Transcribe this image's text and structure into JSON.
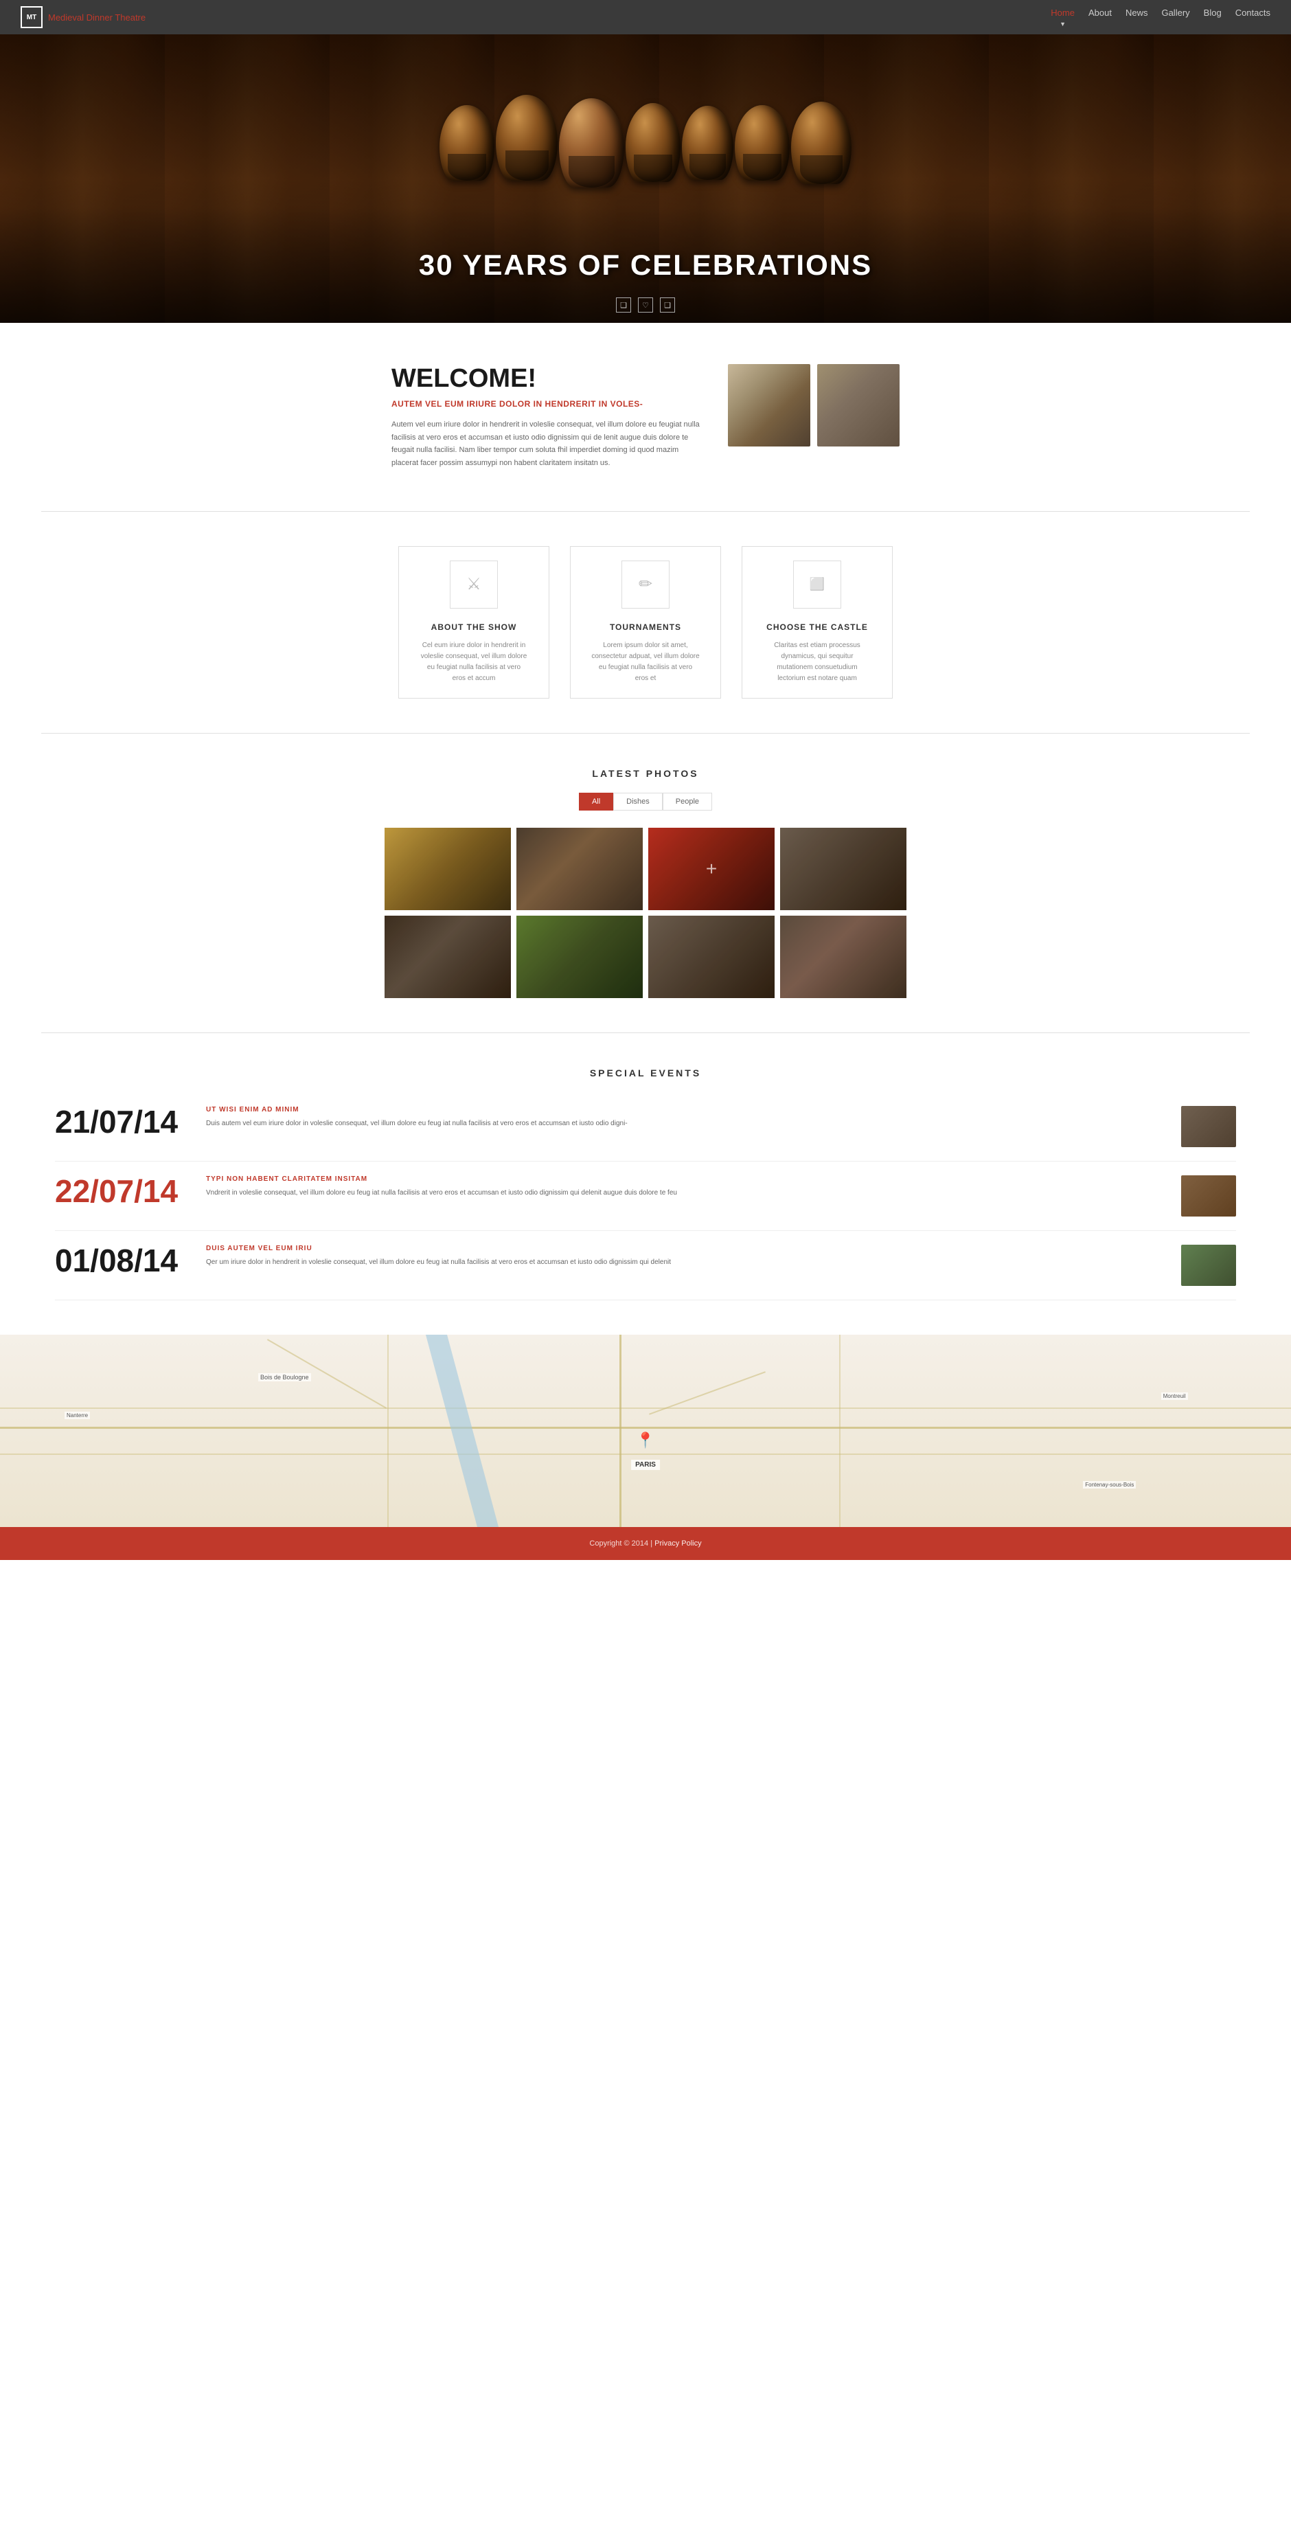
{
  "site": {
    "logo_initials": "MT",
    "logo_brand": "Medieval",
    "logo_highlight": " Dinner Theatre"
  },
  "nav": {
    "links": [
      {
        "label": "Home",
        "active": true
      },
      {
        "label": "About",
        "active": false
      },
      {
        "label": "News",
        "active": false
      },
      {
        "label": "Gallery",
        "active": false
      },
      {
        "label": "Blog",
        "active": false
      },
      {
        "label": "Contacts",
        "active": false
      }
    ]
  },
  "hero": {
    "title": "30 YEARS OF CELEBRATIONS"
  },
  "welcome": {
    "heading": "WELCOME!",
    "subtitle": "AUTEM VEL EUM IRIURE DOLOR IN HENDRERIT IN VOLES-",
    "body": "Autem vel eum iriure dolor in hendrerit in voleslie consequat, vel illum dolore eu feugiat nulla facilisis at vero eros et accumsan et iusto odio dignissim qui de lenit augue duis dolore te feugait nulla facilisi. Nam liber tempor cum soluta fhil imperdiet doming id quod mazim placerat facer possim assumypi non habent claritatem insitatn us."
  },
  "features": [
    {
      "icon": "⚔",
      "title": "ABOUT THE SHOW",
      "body": "Cel eum iriure dolor in hendrerit in voleslie consequat, vel illum dolore eu feugiat nulla facilisis at vero eros et accum"
    },
    {
      "icon": "✏",
      "title": "TOURNAMENTS",
      "body": "Lorem ipsum dolor sit amet, consectetur adpuat, vel illum dolore eu feugiat nulla facilisis at vero eros et"
    },
    {
      "icon": "⬜",
      "title": "CHOOSE THE CASTLE",
      "body": "Claritas est etiam processus dynamicus, qui sequitur mutationem consuetudium lectorium est notare quam"
    }
  ],
  "photos": {
    "section_title": "LATEST PHOTOS",
    "filters": [
      {
        "label": "All",
        "active": true
      },
      {
        "label": "Dishes",
        "active": false
      },
      {
        "label": "People",
        "active": false
      }
    ]
  },
  "events": {
    "section_title": "SPECIAL EVENTS",
    "items": [
      {
        "date": "21/07/14",
        "red": false,
        "tag": "UT WISI ENIM AD MINIM",
        "desc": "Duis autem vel eum iriure dolor in voleslie consequat, vel illum dolore eu feug iat nulla facilisis at vero eros et accumsan et iusto odio digni-"
      },
      {
        "date": "22/07/14",
        "red": true,
        "tag": "TYPI NON HABENT CLARITATEM INSITAM",
        "desc": "Vndrerit in voleslie consequat, vel illum dolore eu feug iat nulla facilisis at vero eros et accumsan et iusto odio dignissim qui  delenit augue duis dolore te feu"
      },
      {
        "date": "01/08/14",
        "red": false,
        "tag": "DUIS AUTEM VEL EUM IRIU",
        "desc": "Qer um iriure dolor in hendrerit in voleslie consequat, vel illum dolore eu feug iat nulla facilisis at vero eros et accumsan et iusto odio dignissim qui  delenit"
      }
    ]
  },
  "footer": {
    "text": "Copyright © 2014 |",
    "policy_label": "Privacy Policy"
  }
}
